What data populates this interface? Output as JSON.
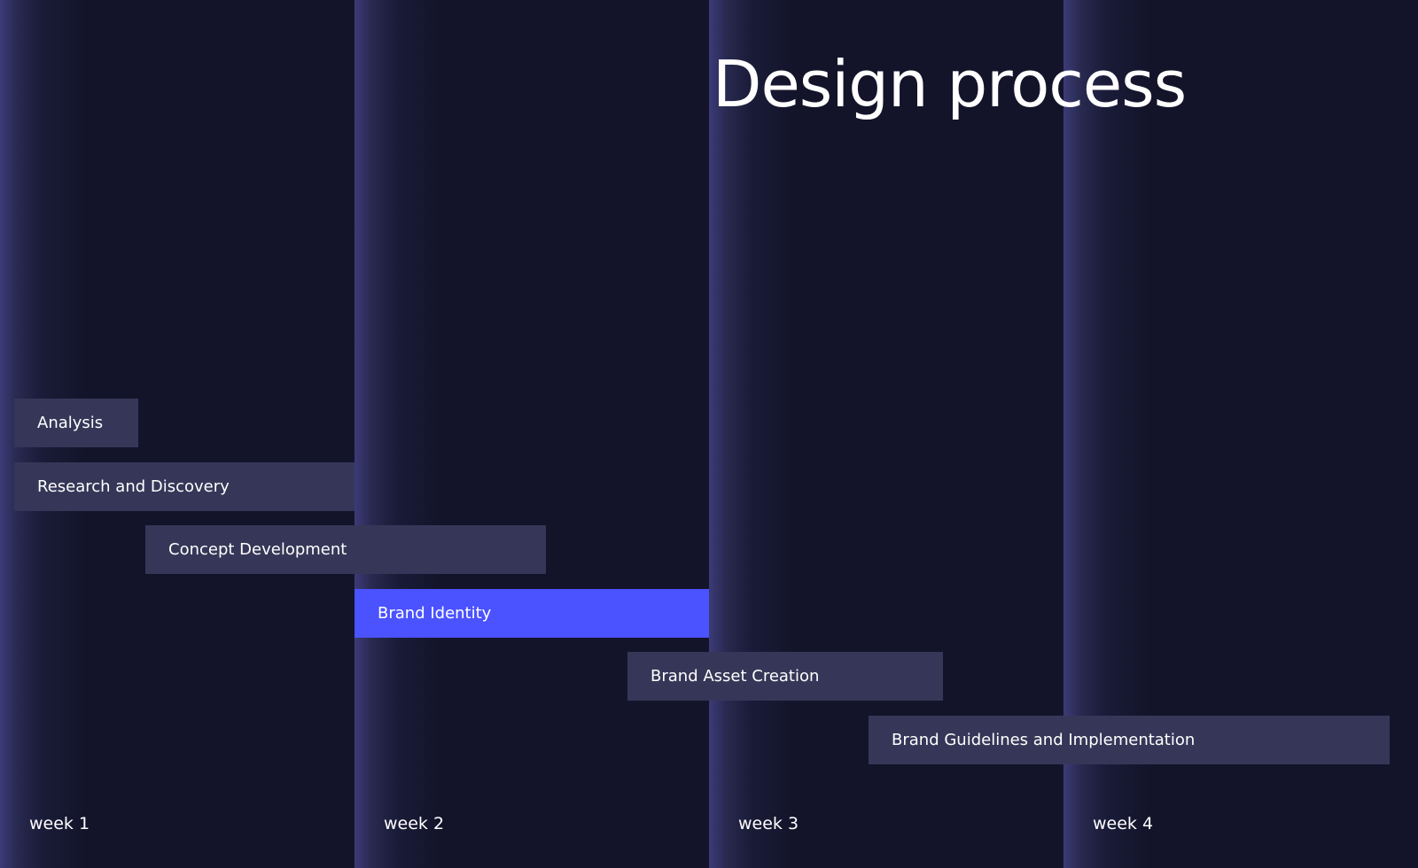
{
  "chart_data": {
    "type": "gantt",
    "title": "Design process",
    "x_unit": "week",
    "xlim": [
      0,
      4
    ],
    "periods": [
      "week 1",
      "week 2",
      "week 3",
      "week 4"
    ],
    "tasks": [
      {
        "label": "Analysis",
        "start": 0.04,
        "end": 0.39,
        "highlight": false
      },
      {
        "label": "Research and Discovery",
        "start": 0.04,
        "end": 1.0,
        "highlight": false
      },
      {
        "label": "Concept Development",
        "start": 0.41,
        "end": 1.54,
        "highlight": false
      },
      {
        "label": "Brand Identity",
        "start": 1.0,
        "end": 2.0,
        "highlight": true
      },
      {
        "label": "Brand Asset Creation",
        "start": 1.77,
        "end": 2.66,
        "highlight": false
      },
      {
        "label": "Brand Guidelines and Implementation",
        "start": 2.45,
        "end": 3.92,
        "highlight": false
      }
    ]
  },
  "colors": {
    "background": "#13142a",
    "bar": "#363758",
    "bar_highlight": "#4b52ff",
    "text": "#ffffff"
  }
}
